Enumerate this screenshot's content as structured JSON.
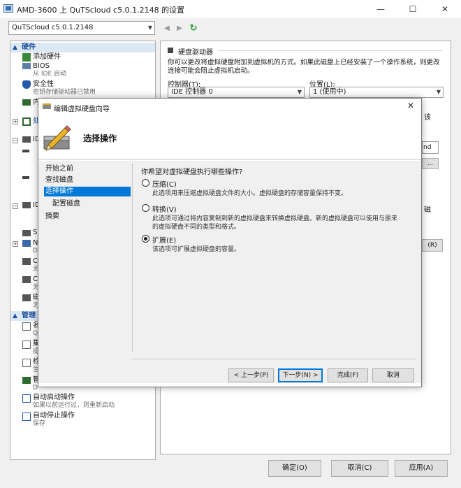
{
  "window": {
    "title": "AMD-3600 上 QuTScloud c5.0.1.2148 的设置"
  },
  "toolbar": {
    "vm_selector": "QuTScloud c5.0.1.2148"
  },
  "sidebar": {
    "hardware_label": "硬件",
    "add_hardware": "添加硬件",
    "bios": "BIOS",
    "bios_sub": "从 IDE 启动",
    "security": "安全性",
    "security_sub": "密钥存储驱动器已禁用",
    "memory_fragment": "内",
    "processor_fragment": "处",
    "ide0_fragment": "ID",
    "ide1_fragment": "ID",
    "scsi_fragment": "SC",
    "network_fragment": "Ne",
    "network_sub_fragment": "D",
    "com1_fragment": "CC",
    "com1_sub_fragment": "无",
    "com2_fragment": "CC",
    "com2_sub_fragment": "无",
    "disk_fragment": "磁",
    "disk_sub_fragment": "无",
    "management_label": "管理",
    "name_fragment": "名",
    "name_sub_fragment": "Q",
    "integration_fragment": "集",
    "integration_sub_fragment": "提",
    "checkpoint_fragment": "检",
    "checkpoint_sub_fragment": "生",
    "smart_paging_fragment": "智",
    "smart_paging_sub_fragment": "D",
    "auto_start": "自动启动操作",
    "auto_start_sub": "如果以前运行过，则重新启动",
    "auto_stop": "自动停止操作",
    "auto_stop_sub": "保存"
  },
  "right_panel": {
    "section_title": "硬盘驱动器",
    "description_line1": "你可以更改将虚拟硬盘附加到虚拟机的方式。如果此磁盘上已经安装了一个操作系统，则更改",
    "description_line2": "连接可能会阻止虚拟机启动。",
    "controller_label": "控制器(T):",
    "controller_value": "IDE 控制器 0",
    "location_label": "位置(L):",
    "location_value": "1 (使用中)",
    "frag_1": "该",
    "frag_2": "nd",
    "frag_3": "...",
    "frag_4": "磁",
    "frag_5": "(R)"
  },
  "footer": {
    "ok": "确定(O)",
    "cancel": "取消(C)",
    "apply": "应用(A)"
  },
  "dialog": {
    "title": "编辑虚拟硬盘向导",
    "heading": "选择操作",
    "steps": [
      "开始之前",
      "查找磁盘",
      "选择操作",
      "配置磁盘",
      "摘要"
    ],
    "active_step": 2,
    "question": "你希望对虚拟硬盘执行哪些操作?",
    "options": [
      {
        "label": "压缩(C)",
        "desc_lines": [
          "此选项用来压缩虚拟硬盘文件的大小。虚拟硬盘的存储容量保持不变。"
        ],
        "selected": false
      },
      {
        "label": "转换(V)",
        "desc_lines": [
          "此选项可通过将内容复制到新的虚拟硬盘来转换虚拟硬盘。新的虚拟硬盘可以使用与原来",
          "的虚拟硬盘不同的类型和格式。"
        ],
        "selected": false
      },
      {
        "label": "扩展(E)",
        "desc_lines": [
          "该选项可扩展虚拟硬盘的容量。"
        ],
        "selected": true
      }
    ],
    "buttons": {
      "prev": "< 上一步(P)",
      "next": "下一步(N) >",
      "finish": "完成(F)",
      "cancel": "取消"
    }
  },
  "colors": {
    "accent": "#0078d7",
    "category_text": "#1c4f9c",
    "category_bg": "#dde8f5"
  }
}
